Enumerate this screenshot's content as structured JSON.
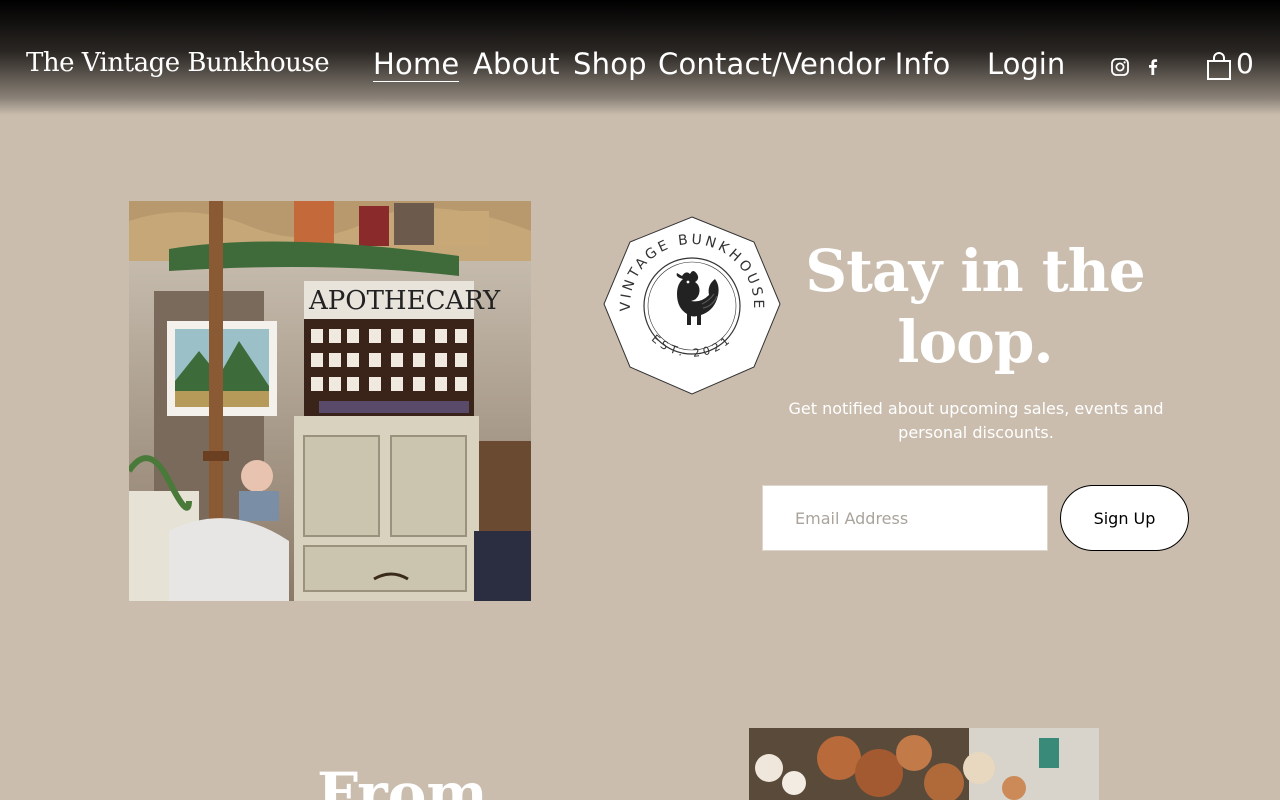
{
  "site": {
    "brand": "The Vintage Bunkhouse"
  },
  "nav": {
    "items": [
      {
        "label": "Home",
        "active": true
      },
      {
        "label": "About"
      },
      {
        "label": "Shop"
      },
      {
        "label": "Contact/Vendor Info"
      }
    ],
    "login_label": "Login",
    "cart_count": "0"
  },
  "badge": {
    "top_text": "VINTAGE BUNKHOUSE",
    "bottom_text": "EST. 2021"
  },
  "newsletter": {
    "title": "Stay in the loop.",
    "subtitle": "Get notified about upcoming sales, events and personal discounts.",
    "email_placeholder": "Email Address",
    "button_label": "Sign Up"
  },
  "next_section": {
    "title": "From"
  },
  "icons": [
    "instagram-icon",
    "facebook-icon",
    "shopping-bag-icon"
  ],
  "colors": {
    "background": "#cabdae",
    "header_top": "#000000",
    "text": "#ffffff"
  }
}
